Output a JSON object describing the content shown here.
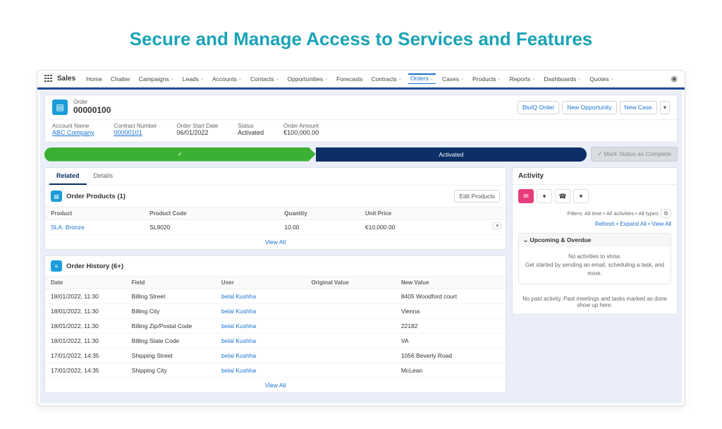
{
  "page_title": "Secure and Manage Access to Services and Features",
  "app_name": "Sales",
  "nav_items": [
    "Home",
    "Chatter",
    "Campaigns",
    "Leads",
    "Accounts",
    "Contacts",
    "Opportunities",
    "Forecasts",
    "Contracts",
    "Orders",
    "Cases",
    "Products",
    "Reports",
    "Dashboards",
    "Quotes"
  ],
  "nav_active_index": 9,
  "header": {
    "label": "Order",
    "number": "00000100",
    "actions": {
      "a1": "BluIQ Order",
      "a2": "New Opportunity",
      "a3": "New Case",
      "more": "▾"
    },
    "fields": {
      "account_name": {
        "label": "Account Name",
        "value": "ABC Company"
      },
      "contract_number": {
        "label": "Contract Number",
        "value": "00000101"
      },
      "order_start_date": {
        "label": "Order Start Date",
        "value": "06/01/2022"
      },
      "status": {
        "label": "Status",
        "value": "Activated"
      },
      "order_amount": {
        "label": "Order Amount",
        "value": "€100,000.00"
      }
    }
  },
  "stage": {
    "done_label": "✓",
    "current": "Activated",
    "mark": "✓ Mark Status as Complete"
  },
  "tabs": {
    "related": "Related",
    "details": "Details"
  },
  "order_products": {
    "title": "Order Products (1)",
    "edit": "Edit Products",
    "cols": {
      "product": "Product",
      "code": "Product Code",
      "qty": "Quantity",
      "unit": "Unit Price"
    },
    "row": {
      "product": "SLA: Bronze",
      "code": "SL9020",
      "qty": "10.00",
      "unit": "€10,000.00"
    },
    "view_all": "View All"
  },
  "order_history": {
    "title": "Order History (6+)",
    "cols": {
      "date": "Date",
      "field": "Field",
      "user": "User",
      "orig": "Original Value",
      "new": "New Value"
    },
    "rows": [
      {
        "date": "18/01/2022, 11:30",
        "field": "Billing Street",
        "user": "belal Kushha",
        "orig": "",
        "new": "8405 Woodford court"
      },
      {
        "date": "18/01/2022, 11:30",
        "field": "Billing City",
        "user": "belal Kushha",
        "orig": "",
        "new": "Vienna"
      },
      {
        "date": "18/01/2022, 11:30",
        "field": "Billing Zip/Postal Code",
        "user": "belal Kushha",
        "orig": "",
        "new": "22182"
      },
      {
        "date": "18/01/2022, 11:30",
        "field": "Billing State Code",
        "user": "belal Kushha",
        "orig": "",
        "new": "VA"
      },
      {
        "date": "17/01/2022, 14:35",
        "field": "Shipping Street",
        "user": "belal Kushha",
        "orig": "",
        "new": "1056 Beverly Road"
      },
      {
        "date": "17/01/2022, 14:35",
        "field": "Shipping City",
        "user": "belal Kushha",
        "orig": "",
        "new": "McLean"
      }
    ],
    "view_all": "View All"
  },
  "activity": {
    "title": "Activity",
    "filter": "Filters: All time • All activities • All types",
    "links": "Refresh • Expand All • View All",
    "upcoming_head": "Upcoming & Overdue",
    "upcoming_body_1": "No activities to show.",
    "upcoming_body_2": "Get started by sending an email, scheduling a task, and more.",
    "past": "No past activity. Past meetings and tasks marked as done show up here."
  }
}
